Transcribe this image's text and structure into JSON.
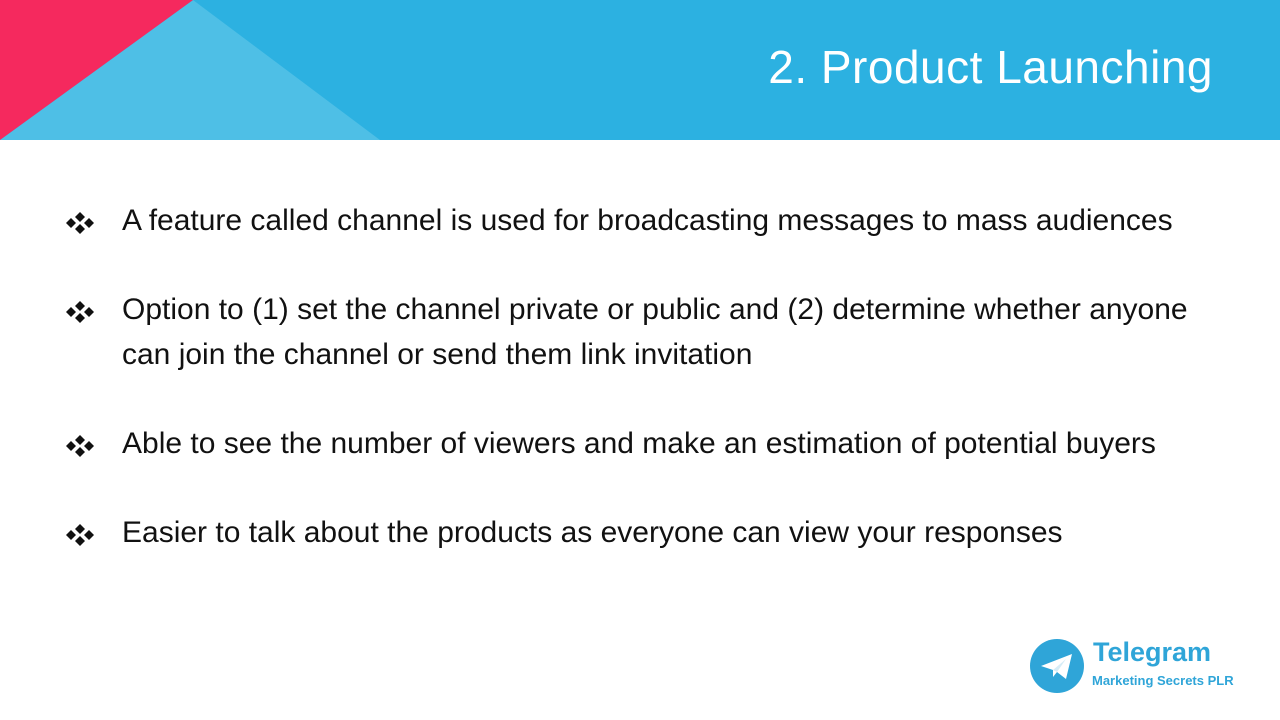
{
  "slide": {
    "title": "2. Product Launching",
    "colors": {
      "header_blue": "#2cb1e1",
      "triangle_light_blue": "#4ebfe6",
      "triangle_pink": "#f5295e",
      "logo_blue": "#2fa5d8"
    }
  },
  "bullets": [
    {
      "icon": "diamond-bullet-icon",
      "text": "A feature called channel is used for broadcasting messages to mass audiences"
    },
    {
      "icon": "diamond-bullet-icon",
      "text": "Option to (1) set the channel private or public and (2) determine whether anyone can join the channel or send them link invitation"
    },
    {
      "icon": "diamond-bullet-icon",
      "text": "Able to see the number of viewers and make an estimation of potential buyers"
    },
    {
      "icon": "diamond-bullet-icon",
      "text": "Easier to talk about the products as everyone can view your responses"
    }
  ],
  "logo": {
    "icon": "telegram-plane-icon",
    "name": "Telegram",
    "subtitle": "Marketing Secrets PLR"
  }
}
